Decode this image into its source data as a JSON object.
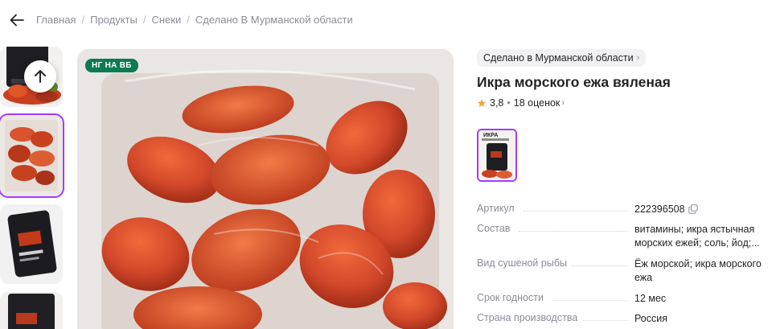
{
  "breadcrumb": {
    "items": [
      "Главная",
      "Продукты",
      "Снеки",
      "Сделано В Мурманской области"
    ],
    "separator": "/"
  },
  "icons": {
    "back": "arrow-left-icon",
    "scroll_up": "arrow-up-icon",
    "rating_star": "star-icon",
    "copy": "copy-icon",
    "chevron": "chevron-right-icon"
  },
  "gallery": {
    "badge": "НГ НА ВБ",
    "thumb_count_visible": 4,
    "selected_index": 1
  },
  "product": {
    "brand": "Сделано в Мурманской области",
    "title": "Икра морского ежа вяленая",
    "rating": "3,8",
    "reviews": "18 оценок",
    "variant_label": "ИКРА"
  },
  "specs": [
    {
      "label": "Артикул",
      "value": "222396508"
    },
    {
      "label": "Состав",
      "value": "витамины; икра ястычная морских ежей; соль; йод;..."
    },
    {
      "label": "Вид сушеной рыбы",
      "value": "Ёж морской; икра морского ежа"
    },
    {
      "label": "Срок годности",
      "value": "12 мес"
    },
    {
      "label": "Страна производства",
      "value": "Россия"
    }
  ],
  "colors": {
    "accent": "#a73afd",
    "badge_green": "#0d7a52",
    "muted_text": "#8b8b99",
    "star": "#f2a93b"
  }
}
